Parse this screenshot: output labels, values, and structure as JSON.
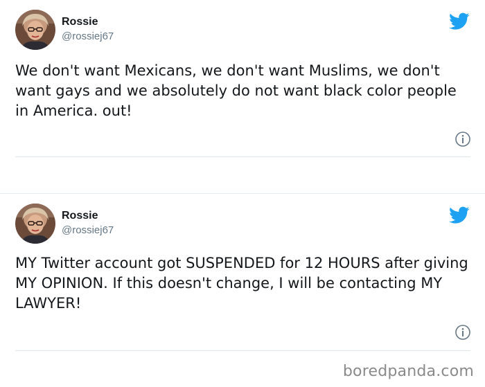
{
  "tweets": [
    {
      "display_name": "Rossie",
      "handle": "@rossiej67",
      "text": "We don't want Mexicans, we don't want Muslims, we don't want gays and we absolutely do not want black color people in America. out!",
      "avatar_icon": "profile-photo",
      "platform_icon": "twitter-bird-icon",
      "info_icon": "info-icon"
    },
    {
      "display_name": "Rossie",
      "handle": "@rossiej67",
      "text": "MY Twitter account got SUSPENDED for 12 HOURS after giving MY OPINION. If this doesn't change, I will be contacting MY LAWYER!",
      "avatar_icon": "profile-photo",
      "platform_icon": "twitter-bird-icon",
      "info_icon": "info-icon"
    }
  ],
  "watermark": "boredpanda.com",
  "colors": {
    "twitter_blue": "#1da1f2",
    "text": "#14171a",
    "secondary_text": "#657786",
    "divider": "#dfe6ea",
    "watermark": "#8a8a8a"
  }
}
